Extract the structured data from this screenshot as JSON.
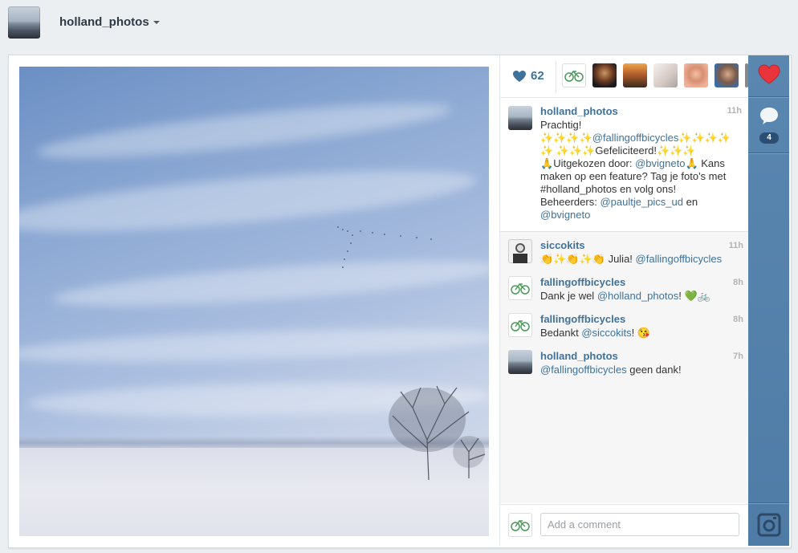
{
  "header": {
    "username": "holland_photos"
  },
  "post": {
    "likes_count": "62",
    "caption": {
      "author": "holland_photos",
      "time": "11h",
      "line1": "Prachtig!",
      "mention_main": "@fallingoffbicycles",
      "congrats": "Gefeliciteerd!",
      "chosen_by": "Uitgekozen door:",
      "mention_chooser": "@bvigneto",
      "feature_text": "Kans maken op een feature? Tag je foto's met #holland_photos en volg ons!",
      "admins": "Beheerders:",
      "mention_admin1": "@paultje_pics_ud",
      "and": "en",
      "mention_admin2": "@bvigneto"
    },
    "comments": [
      {
        "author": "siccokits",
        "time": "11h",
        "text": "Julia!",
        "mention": "@fallingoffbicycles"
      },
      {
        "author": "fallingoffbicycles",
        "time": "8h",
        "text_before": "Dank je wel",
        "mention": "@holland_photos",
        "text_after": "!"
      },
      {
        "author": "fallingoffbicycles",
        "time": "8h",
        "text_before": "Bedankt",
        "mention": "@siccokits",
        "text_after": "!"
      },
      {
        "author": "holland_photos",
        "time": "7h",
        "mention": "@fallingoffbicycles",
        "text_after": "geen dank!"
      }
    ],
    "add_comment_placeholder": "Add a comment",
    "comments_badge": "4"
  },
  "colors": {
    "link": "#3f729b",
    "rail": "#5583ad",
    "heart": "#e8343a"
  },
  "icons": [
    "chevron-down-icon",
    "heart-icon",
    "like-heart-icon",
    "comment-bubble-icon",
    "instagram-camera-icon"
  ]
}
